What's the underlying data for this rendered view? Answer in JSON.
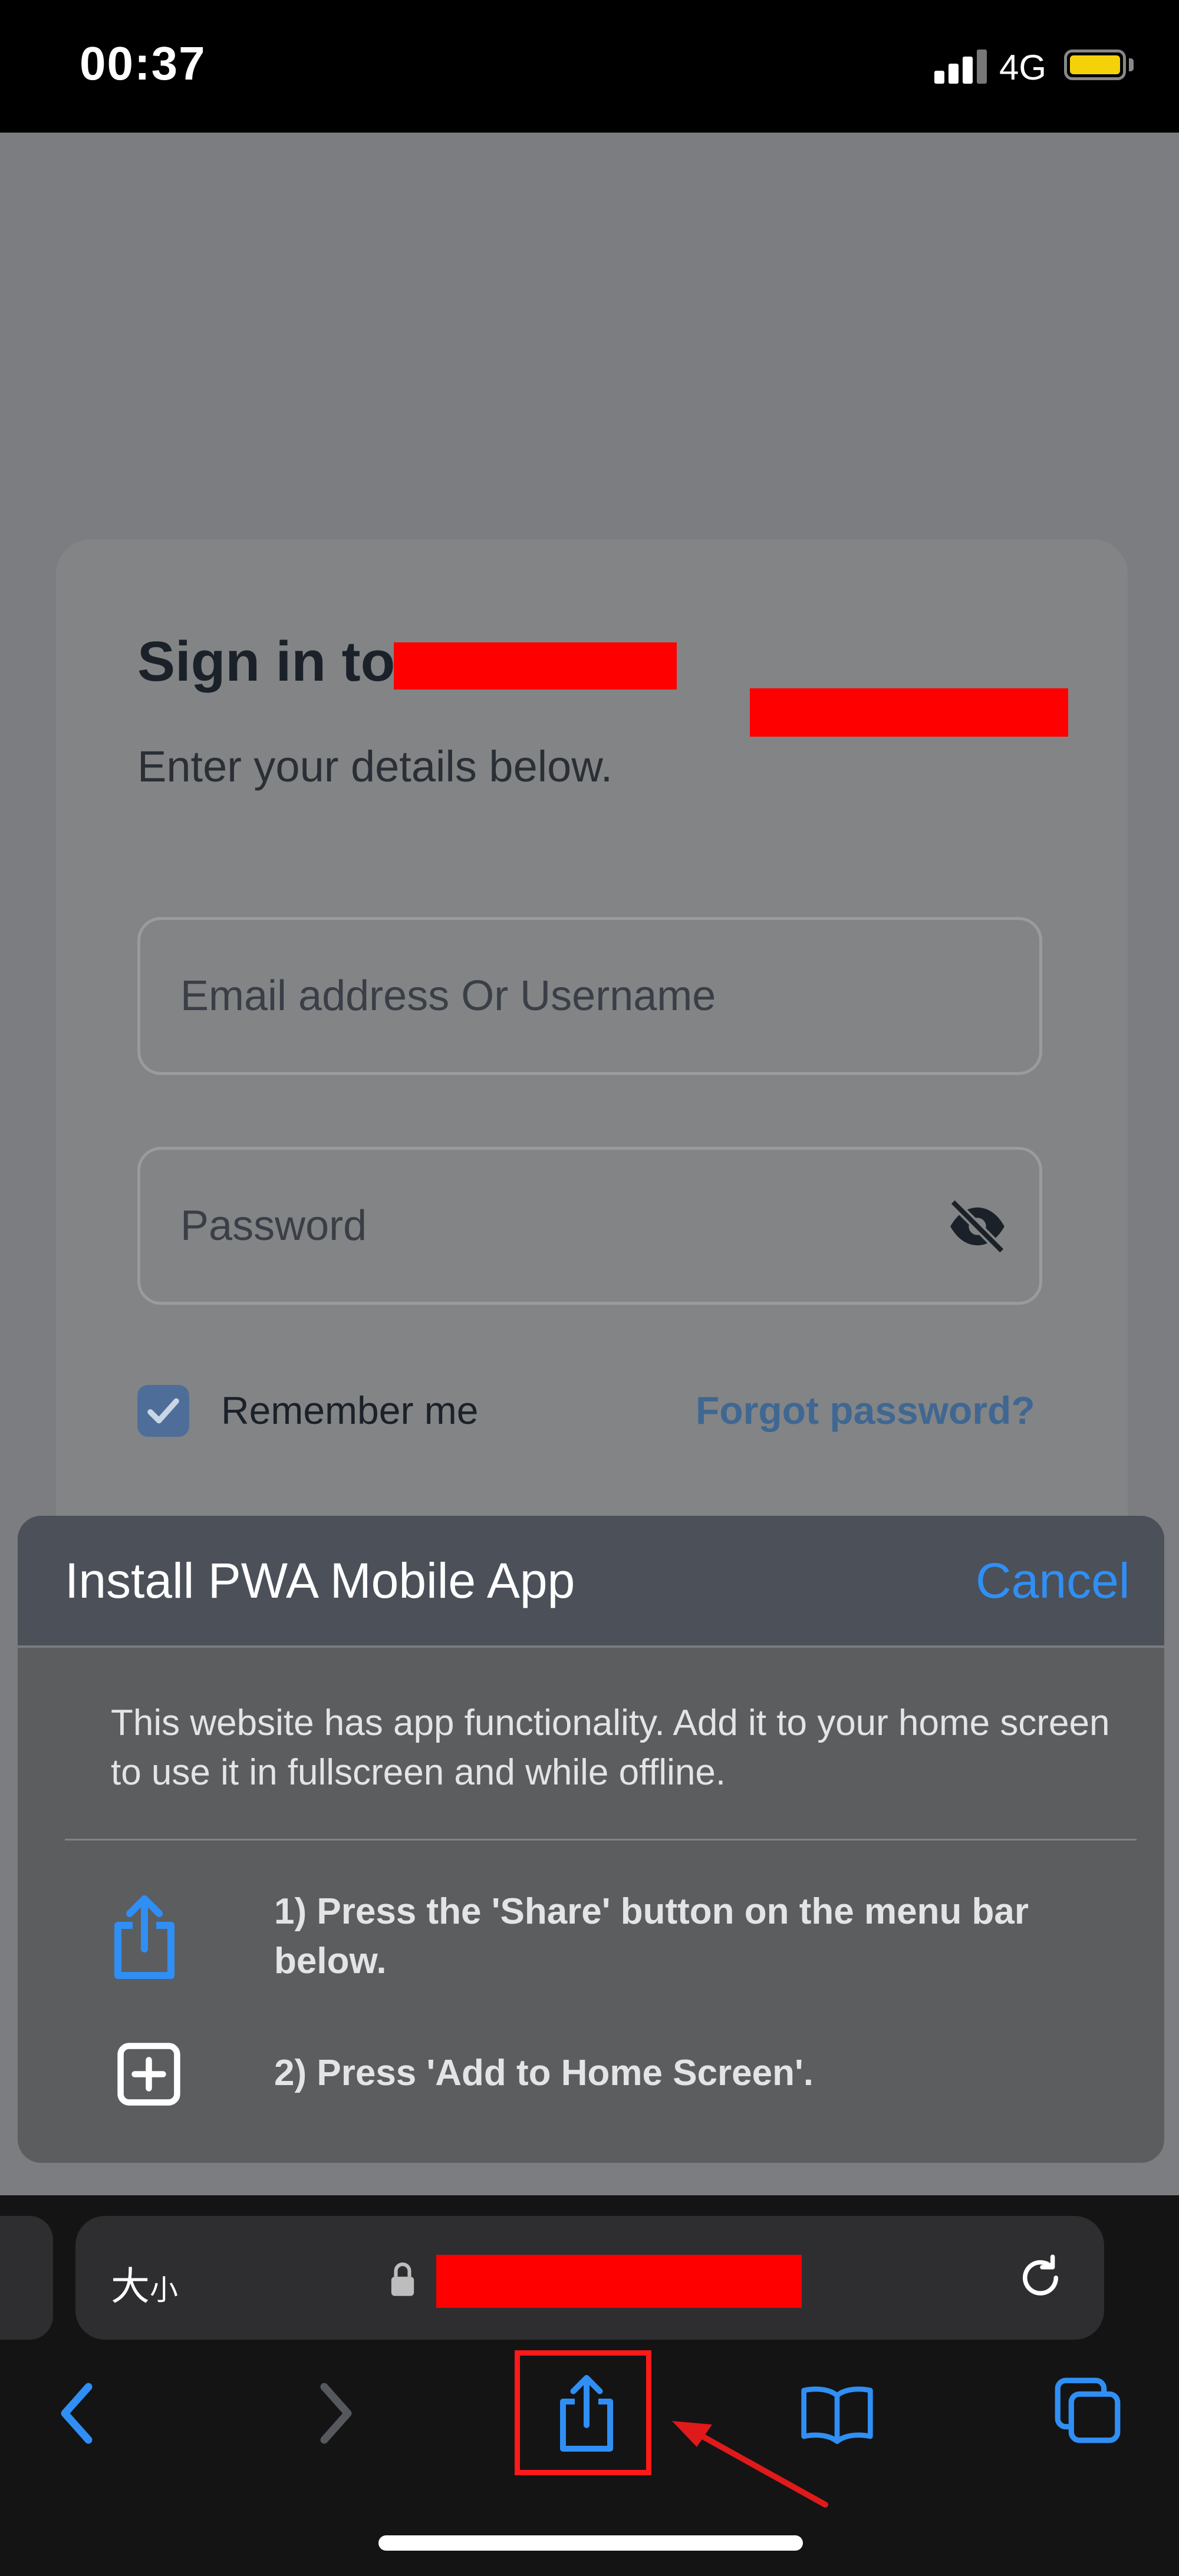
{
  "status_bar": {
    "time": "00:37",
    "network": "4G",
    "icons": [
      "cellular-signal-icon",
      "battery-icon"
    ],
    "battery_color": "#f5d10a"
  },
  "signin": {
    "title": "Sign in to",
    "subtitle": "Enter your details below.",
    "email_placeholder": "Email address Or Username",
    "password_placeholder": "Password",
    "remember_label": "Remember me",
    "remember_checked": true,
    "forgot_label": "Forgot password?",
    "icons": [
      "eye-off-icon",
      "checkmark-icon"
    ]
  },
  "pwa_sheet": {
    "title": "Install PWA Mobile App",
    "cancel_label": "Cancel",
    "description": "This website has app functionality. Add it to your home screen to use it in fullscreen and while offline.",
    "steps": [
      {
        "icon": "share-icon",
        "text": "1) Press the 'Share' button on the menu bar below."
      },
      {
        "icon": "add-square-icon",
        "text": "2) Press 'Add to Home Screen'."
      }
    ],
    "accent_color": "#2f8ff5"
  },
  "browser_bar": {
    "text_size_label": "大",
    "text_size_small": "小",
    "icons": [
      "lock-icon",
      "reload-icon",
      "back-icon",
      "forward-icon",
      "share-icon",
      "bookmarks-icon",
      "tabs-icon"
    ]
  },
  "annotations": {
    "highlight_color": "#ff1a1a",
    "redaction_color": "#ff0000"
  }
}
